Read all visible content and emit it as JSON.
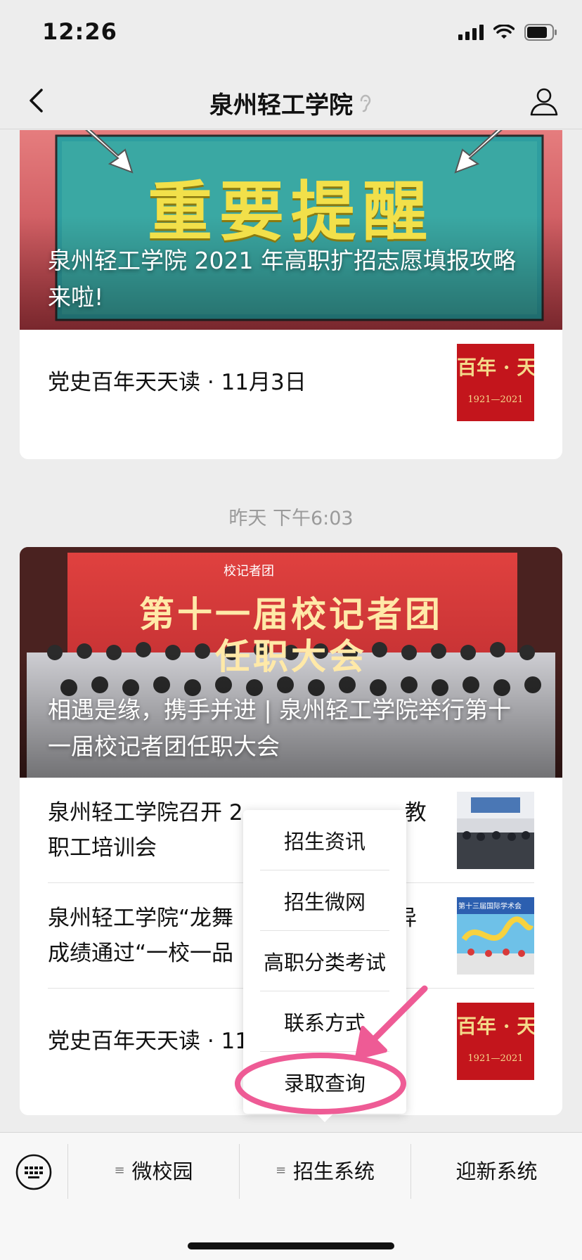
{
  "status_bar": {
    "time": "12:26"
  },
  "nav": {
    "title": "泉州轻工学院"
  },
  "group1": {
    "cover_title": "泉州轻工学院 2021 年高职扩招志愿填报攻略来啦!",
    "cover_banner_text": "重要提醒",
    "items": [
      {
        "title": "党史百年天天读 · 11月3日",
        "thumb_text": "百年 · 天",
        "thumb_sub": "1921—2021"
      }
    ]
  },
  "timestamp": "昨天 下午6:03",
  "group2": {
    "cover_title": "相遇是缘，携手并进 | 泉州轻工学院举行第十一届校记者团任职大会",
    "cover_banner_text": "第十一届校记者团",
    "cover_banner_text2": "任职大会",
    "cover_banner_org": "校记者团",
    "items": [
      {
        "title": "泉州轻工学院召开 2",
        "title_tail": "教",
        "title_line2": "职工培训会"
      },
      {
        "title": "泉州轻工学院“龙舞",
        "title_tail": "异",
        "title_line2": "成绩通过“一校一品",
        "thumb_text": "第十三届国际学术会"
      },
      {
        "title": "党史百年天天读 · 11",
        "thumb_text": "百年 · 天",
        "thumb_sub": "1921—2021"
      }
    ]
  },
  "popup_menu": {
    "items": [
      "招生资讯",
      "招生微网",
      "高职分类考试",
      "联系方式",
      "录取查询"
    ],
    "highlighted_item": "录取查询"
  },
  "bottom_menu": {
    "items": [
      "微校园",
      "招生系统",
      "迎新系统"
    ]
  },
  "colors": {
    "annotation_pink": "#ee5b95",
    "banner_red": "#c7232a",
    "banner_teal": "#3aa8a3",
    "banner_yellow": "#f2e04a"
  }
}
